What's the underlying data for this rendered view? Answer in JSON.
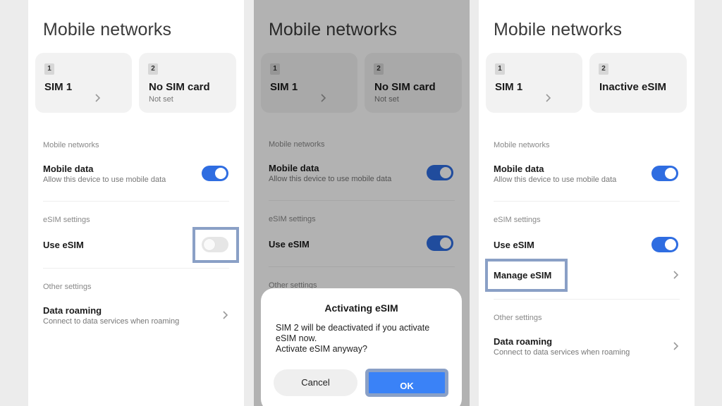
{
  "accent_color": "#2f6de1",
  "highlight_color": "#8aa0c6",
  "panels": [
    {
      "title": "Mobile networks",
      "sim1": {
        "num": "1",
        "name": "SIM 1"
      },
      "sim2": {
        "num": "2",
        "name": "No SIM card",
        "sub": "Not set"
      },
      "sections": {
        "networks": "Mobile networks",
        "esim": "eSIM settings",
        "other": "Other settings"
      },
      "mobile_data": {
        "title": "Mobile data",
        "sub": "Allow this device to use mobile data",
        "on": true
      },
      "use_esim": {
        "title": "Use eSIM",
        "on": false
      },
      "data_roaming": {
        "title": "Data roaming",
        "sub": "Connect to data services when roaming"
      }
    },
    {
      "title": "Mobile networks",
      "sim1": {
        "num": "1",
        "name": "SIM 1"
      },
      "sim2": {
        "num": "2",
        "name": "No SIM card",
        "sub": "Not set"
      },
      "sections": {
        "networks": "Mobile networks",
        "esim": "eSIM settings",
        "other": "Other settings"
      },
      "mobile_data": {
        "title": "Mobile data",
        "sub": "Allow this device to use mobile data",
        "on": true
      },
      "use_esim": {
        "title": "Use eSIM",
        "on": true
      },
      "dialog": {
        "title": "Activating eSIM",
        "line1": "SIM 2 will be deactivated if you activate",
        "line2": "eSIM now.",
        "line3": "Activate eSIM anyway?",
        "cancel": "Cancel",
        "ok": "OK"
      }
    },
    {
      "title": "Mobile networks",
      "sim1": {
        "num": "1",
        "name": "SIM 1"
      },
      "sim2": {
        "num": "2",
        "name": "Inactive eSIM"
      },
      "sections": {
        "networks": "Mobile networks",
        "esim": "eSIM settings",
        "other": "Other settings"
      },
      "mobile_data": {
        "title": "Mobile data",
        "sub": "Allow this device to use mobile data",
        "on": true
      },
      "use_esim": {
        "title": "Use eSIM",
        "on": true
      },
      "manage_esim": {
        "title": "Manage eSIM"
      },
      "data_roaming": {
        "title": "Data roaming",
        "sub": "Connect to data services when roaming"
      }
    }
  ]
}
